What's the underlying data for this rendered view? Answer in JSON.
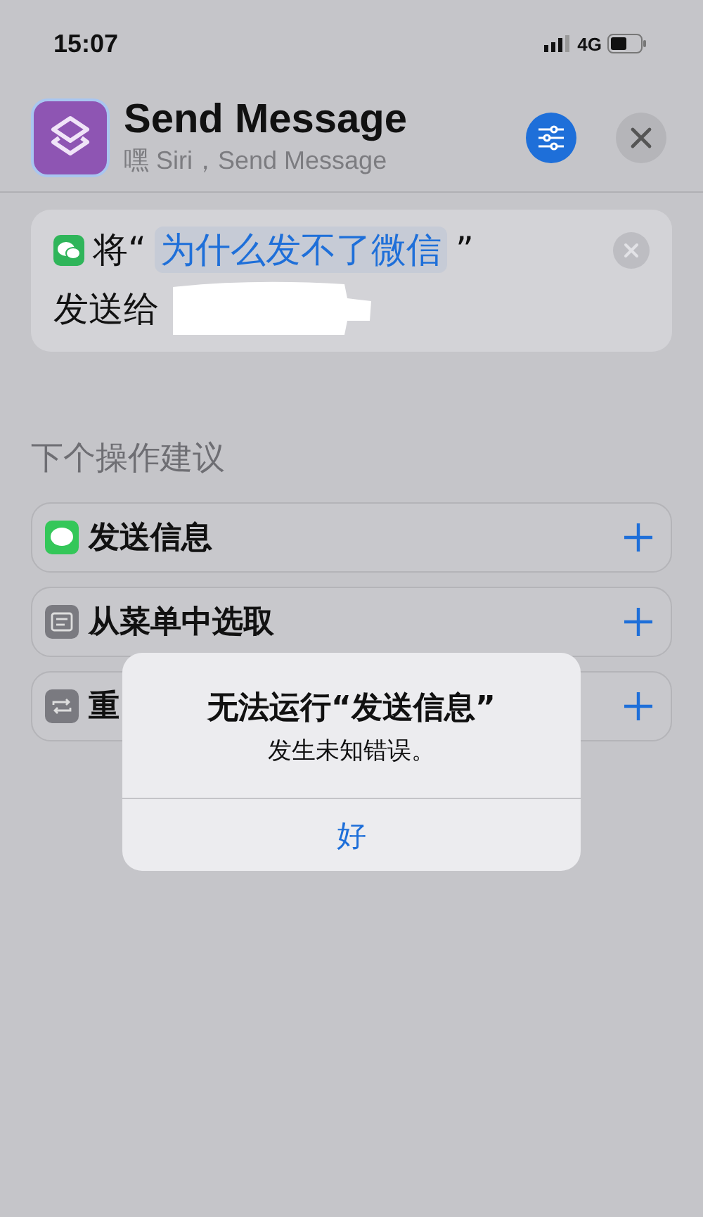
{
  "status_bar": {
    "time": "15:07",
    "network": "4G"
  },
  "header": {
    "title": "Send Message",
    "subtitle": "嘿 Siri，Send Message"
  },
  "action": {
    "prefix": "将“",
    "parameter": "为什么发不了微信",
    "suffix": "”",
    "line2": "发送给"
  },
  "suggestions": {
    "heading": "下个操作建议",
    "items": [
      {
        "kind": "message",
        "label": "发送信息"
      },
      {
        "kind": "menu",
        "label": "从菜单中选取"
      },
      {
        "kind": "repeat",
        "label": "重"
      }
    ]
  },
  "alert": {
    "title": "无法运行“发送信息”",
    "message": "发生未知错误。",
    "buttons": [
      "好"
    ]
  }
}
